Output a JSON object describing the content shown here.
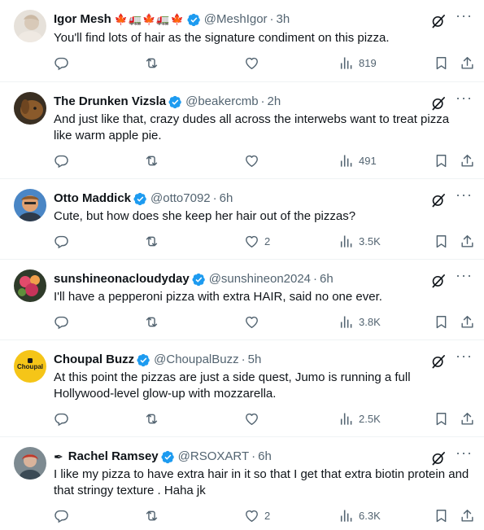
{
  "tweets": [
    {
      "name": "Igor Mesh",
      "name_suffix": "🍁🚛🍁🚛🍁",
      "handle": "@MeshIgor",
      "separator": "·",
      "time": "3h",
      "text": "You'll find lots of hair as the signature condiment on this pizza.",
      "replies": "",
      "retweets": "",
      "likes": "",
      "views": "819",
      "more_label": "···"
    },
    {
      "name": "The Drunken Vizsla",
      "handle": "@beakercmb",
      "separator": "·",
      "time": "2h",
      "text": "And just like that, crazy dudes all across the interwebs want to treat pizza like warm apple pie.",
      "replies": "",
      "retweets": "",
      "likes": "",
      "views": "491",
      "more_label": "···"
    },
    {
      "name": "Otto Maddick",
      "handle": "@otto7092",
      "separator": "·",
      "time": "6h",
      "text": "Cute, but how does she keep her hair out of the pizzas?",
      "replies": "",
      "retweets": "",
      "likes": "2",
      "views": "3.5K",
      "more_label": "···"
    },
    {
      "name": "sunshineonacloudyday",
      "handle": "@sunshineon2024",
      "separator": "·",
      "time": "6h",
      "text": "I'll have a pepperoni pizza with extra HAIR, said no one ever.",
      "replies": "",
      "retweets": "",
      "likes": "",
      "views": "3.8K",
      "more_label": "···"
    },
    {
      "name": "Choupal Buzz",
      "handle": "@ChoupalBuzz",
      "separator": "·",
      "time": "5h",
      "text": "At this point the pizzas are just a side quest, Jumo is running a full Hollywood-level glow-up with mozzarella.",
      "replies": "",
      "retweets": "",
      "likes": "",
      "views": "2.5K",
      "more_label": "···",
      "avatar_label": "Choupal"
    },
    {
      "name": "Rachel Ramsey",
      "name_prefix": "✒",
      "handle": "@RSOXART",
      "separator": "·",
      "time": "6h",
      "text": "I like my pizza to have extra hair in it so that I get that extra biotin protein and that stringy texture . Haha jk",
      "replies": "",
      "retweets": "",
      "likes": "2",
      "views": "6.3K",
      "more_label": "···"
    }
  ],
  "colors": {
    "text": "#0f1419",
    "secondary": "#536471",
    "verified": "#1d9bf0",
    "divider": "#eff3f4"
  },
  "icons": [
    "reply-icon",
    "retweet-icon",
    "like-icon",
    "views-icon",
    "bookmark-icon",
    "share-icon",
    "grok-icon",
    "more-icon",
    "verified-icon"
  ]
}
